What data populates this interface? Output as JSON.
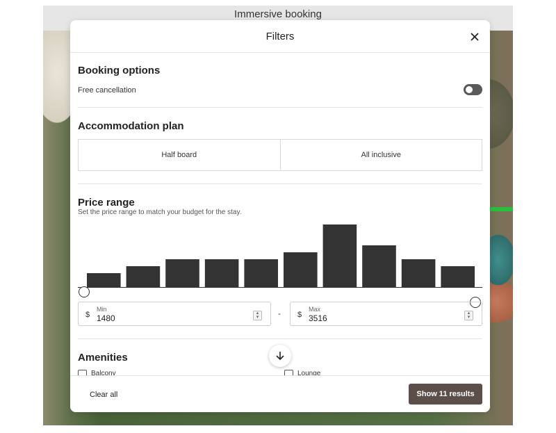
{
  "background": {
    "title": "Immersive booking"
  },
  "modal": {
    "title": "Filters",
    "close_icon": "close-icon"
  },
  "booking_options": {
    "title": "Booking options",
    "free_cancellation_label": "Free cancellation",
    "free_cancellation_on": false
  },
  "accommodation": {
    "title": "Accommodation plan",
    "options": [
      "Half board",
      "All inclusive"
    ]
  },
  "price": {
    "title": "Price range",
    "subtitle": "Set the price range to match your budget for the stay.",
    "currency": "$",
    "min_label": "Min",
    "min_value": "1480",
    "max_label": "Max",
    "max_value": "3516",
    "separator": "-"
  },
  "chart_data": {
    "type": "bar",
    "values": [
      2,
      3,
      4,
      4,
      4,
      5,
      9,
      6,
      4,
      3
    ]
  },
  "amenities": {
    "title": "Amenities",
    "items": [
      "Balcony",
      "Lounge"
    ]
  },
  "footer": {
    "clear_label": "Clear all",
    "show_label": "Show 11 results"
  },
  "colors": {
    "bar": "#333333",
    "primary_button": "#5c4f4a",
    "toggle_off": "#5a5a5a"
  }
}
